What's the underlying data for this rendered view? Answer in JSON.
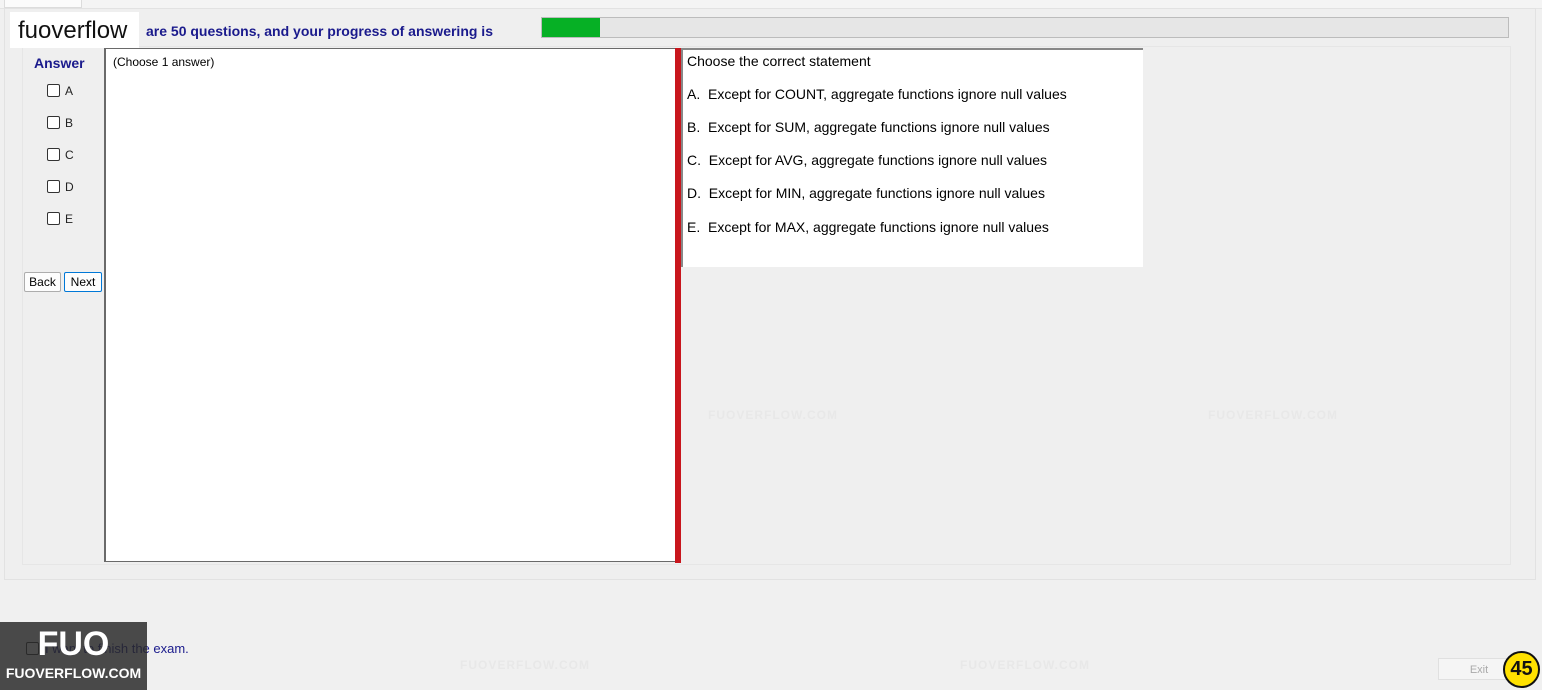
{
  "brand": {
    "name": "fuoverflow"
  },
  "header": {
    "progress_text": "are 50 questions, and your progress of answering is",
    "progress_value": 0.06
  },
  "answer": {
    "title": "Answer",
    "options": [
      "A",
      "B",
      "C",
      "D",
      "E"
    ],
    "back_label": "Back",
    "next_label": "Next"
  },
  "left_panel": {
    "choose_count": "(Choose 1 answer)"
  },
  "question": {
    "title": "Choose the correct statement",
    "options": [
      "A.  Except for COUNT, aggregate functions ignore null values",
      "B.  Except for SUM, aggregate functions ignore null values",
      "C.  Except for AVG, aggregate functions ignore null values",
      "D.  Except for MIN, aggregate functions ignore null values",
      "E.  Except for MAX, aggregate functions ignore null values"
    ]
  },
  "footer": {
    "finish_label": "I want to finish the exam.",
    "exit_label": "Exit",
    "badge": "45"
  },
  "watermark": {
    "text": "FUOVERFLOW.COM",
    "logo_big": "FUO",
    "logo_small": "FUOVERFLOW.COM"
  },
  "colors": {
    "progress_fill": "#06b025",
    "header_text": "#1a1a8c",
    "divider": "#c8161d",
    "badge": "#ffe100"
  }
}
